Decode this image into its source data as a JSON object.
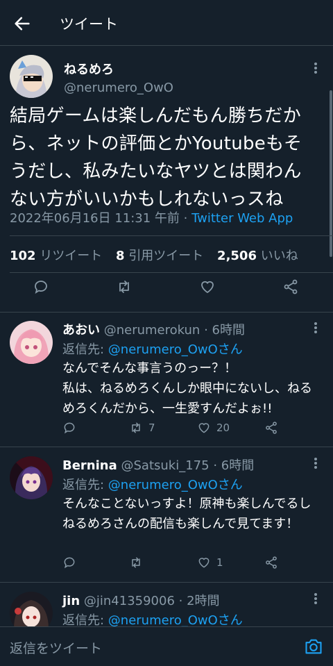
{
  "header": {
    "title": "ツイート"
  },
  "tweet": {
    "display_name": "ねるめろ",
    "handle": "@nerumero_OwO",
    "text_lines": [
      "結局ゲームは楽しんだもん勝ちだか",
      "ら、ネットの評価とかYoutubeもそ",
      "うだし、私みたいなヤツとは関わん",
      "ない方がいいかもしれないっスね"
    ],
    "timestamp": "2022年06月16日 11:31 午前",
    "separator": "·",
    "app": "Twitter Web App",
    "stats": {
      "retweets_count": "102",
      "retweets_label": "リツイート",
      "quotes_count": "8",
      "quotes_label": "引用ツイート",
      "likes_count": "2,506",
      "likes_label": "いいね"
    }
  },
  "replies": [
    {
      "display_name": "あおい",
      "handle": "@nerumerokun",
      "time": "· 6時間",
      "reply_label": "返信先: ",
      "reply_to": "@nerumero_OwOさん",
      "text": "なんでそんな事言うのっー？！\n私は、ねるめろくんしか眼中にないし、ねるめろくんだから、一生愛すんだよぉ!!",
      "retweets": "7",
      "likes": "20"
    },
    {
      "display_name": "Bernina",
      "handle": "@Satsuki_175",
      "time": "· 6時間",
      "reply_label": "返信先: ",
      "reply_to": "@nerumero_OwOさん",
      "text": "そんなことないっすよ！原神も楽しんでるしねるめろさんの配信も楽しんで見てます！",
      "retweets": "",
      "likes": "1"
    },
    {
      "display_name": "jin",
      "handle": "@jin41359006",
      "time": "· 2時間",
      "reply_label": "返信先: ",
      "reply_to": "@nerumero_OwOさん"
    }
  ],
  "composer": {
    "placeholder": "返信をツイート"
  },
  "colors": {
    "background": "#15202b",
    "accent": "#1da1f2",
    "muted": "#8899a6",
    "border": "#38444d"
  }
}
